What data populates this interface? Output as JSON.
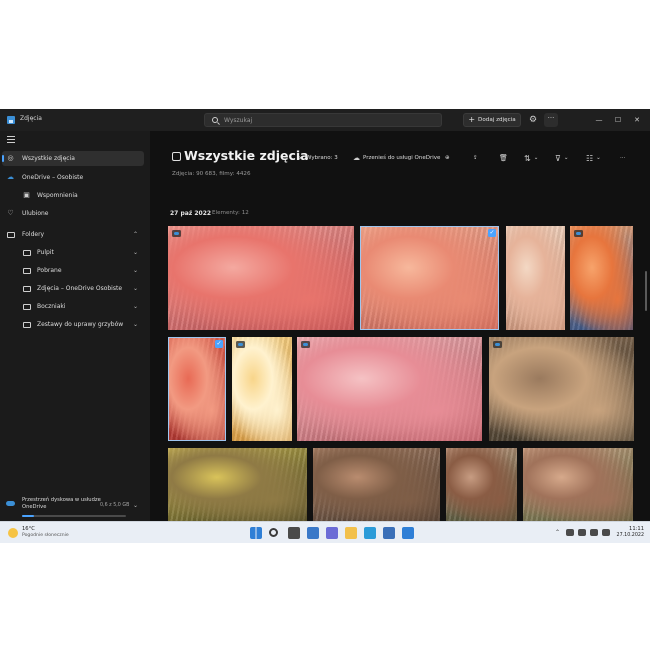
{
  "window": {
    "title": "Zdjęcia",
    "search_placeholder": "Wyszukaj",
    "add_photos_label": "Dodaj zdjęcia",
    "add_photos_plus": "+",
    "settings_glyph": "⚙",
    "more_glyph": "···",
    "minimize_glyph": "—",
    "maximize_glyph": "☐",
    "close_glyph": "✕"
  },
  "sidebar": {
    "items": [
      {
        "label": "Wszystkie zdjęcia",
        "icon": "photos-icon",
        "glyph": "◎"
      },
      {
        "label": "OneDrive – Osobiste",
        "icon": "cloud-icon",
        "glyph": "☁",
        "chev": "⌃"
      },
      {
        "label": "Wspomnienia",
        "icon": "memories-icon",
        "glyph": "▣"
      },
      {
        "label": "Ulubione",
        "icon": "heart-icon",
        "glyph": "♡"
      },
      {
        "label": "Foldery",
        "icon": "folder-icon",
        "chev": "⌃"
      },
      {
        "label": "Pulpit",
        "icon": "folder-icon",
        "chev": "⌄"
      },
      {
        "label": "Pobrane",
        "icon": "folder-icon",
        "chev": "⌄"
      },
      {
        "label": "Zdjęcia – OneDrive Osobiste",
        "icon": "folder-icon",
        "chev": "⌄"
      },
      {
        "label": "Boczniaki",
        "icon": "folder-icon",
        "chev": "⌄"
      },
      {
        "label": "Zestawy do uprawy grzybów",
        "icon": "folder-icon",
        "chev": "⌄"
      }
    ],
    "storage": {
      "title": "Przestrzeń dyskowa w usłudze OneDrive",
      "size": "0,6 z 5,0 GB",
      "chev": "⌄",
      "used_fraction": 0.12
    }
  },
  "main": {
    "title": "Wszystkie zdjęcia",
    "counts": "Zdjęcia: 90 683, filmy: 4426",
    "toolbar": {
      "deselect_label": "Wybrano: 3",
      "move_label": "Przenieś do usługi OneDrive",
      "deselect_glyph": "✕",
      "move_glyph": "☁",
      "zoom_glyph": "⊕",
      "share_glyph": "⇪",
      "delete_glyph": "🗑",
      "sort_glyph": "⇅",
      "filter_glyph": "⊽",
      "view_glyph": "☷",
      "more_glyph": "···",
      "chev": "⌄"
    },
    "date_heading": "27 paź 2022",
    "elements_label": "Elementy: 12",
    "check_glyph": "✓"
  },
  "photos": [
    {
      "name": "photo-pink-oyster-cluster",
      "selected": false,
      "badge": true,
      "c1": "#f4a9a0",
      "c2": "#b9444a",
      "c3": "#e8746c"
    },
    {
      "name": "photo-peach-gills-closeup",
      "selected": true,
      "badge": false,
      "c1": "#f7b89c",
      "c2": "#c65a4f",
      "c3": "#e98a73"
    },
    {
      "name": "photo-beige-oyster-stack",
      "selected": false,
      "badge": false,
      "c1": "#f3d8c4",
      "c2": "#c98f74",
      "c3": "#e6b39a"
    },
    {
      "name": "photo-orange-oyster-blue",
      "selected": false,
      "badge": true,
      "c1": "#f7a36b",
      "c2": "#1f4d8f",
      "c3": "#e7753d"
    },
    {
      "name": "photo-red-gills",
      "selected": true,
      "badge": false,
      "c1": "#e86a55",
      "c2": "#a62d2a",
      "c3": "#f29a82"
    },
    {
      "name": "photo-golden-oyster",
      "selected": false,
      "badge": true,
      "c1": "#f8d58a",
      "c2": "#d6953a",
      "c3": "#fff2cf"
    },
    {
      "name": "photo-pink-oyster-mound",
      "selected": false,
      "badge": true,
      "c1": "#f5c2c4",
      "c2": "#b4505a",
      "c3": "#e78d96"
    },
    {
      "name": "photo-brown-caps-forest",
      "selected": false,
      "badge": true,
      "c1": "#9a7a5e",
      "c2": "#2d2a1f",
      "c3": "#c8a37e"
    },
    {
      "name": "photo-yellow-stems-moss",
      "selected": false,
      "badge": false,
      "c1": "#d9c35a",
      "c2": "#3b3a1a",
      "c3": "#8f7a45"
    },
    {
      "name": "photo-large-brown-caps",
      "selected": false,
      "badge": false,
      "c1": "#b98c6f",
      "c2": "#3a2f26",
      "c3": "#7f5e47"
    },
    {
      "name": "photo-woman-holding-mushroom",
      "selected": false,
      "badge": false,
      "c1": "#c79c82",
      "c2": "#3e4a2e",
      "c3": "#8a5c44"
    },
    {
      "name": "photo-woman-smelling-mushroom",
      "selected": false,
      "badge": false,
      "c1": "#d6a98b",
      "c2": "#4a5a33",
      "c3": "#a0725a"
    }
  ],
  "taskbar": {
    "weather_temp": "16°C",
    "weather_desc": "Pogodnie słonecznie",
    "tray_chev": "⌃",
    "clock_time": "11:11",
    "clock_date": "27.10.2022",
    "icons": [
      "windows-start-icon",
      "taskbar-search-icon",
      "task-view-icon",
      "widgets-icon",
      "chat-icon",
      "file-explorer-icon",
      "edge-icon",
      "store-icon",
      "photos-app-icon"
    ],
    "icon_colors": [
      "#2f7fd6",
      "#3a3a3a",
      "#4a4a4a",
      "#3a78c8",
      "#6b6bd6",
      "#f2c04b",
      "#2b9bd8",
      "#3a6fb8",
      "#2f7fd6"
    ]
  }
}
